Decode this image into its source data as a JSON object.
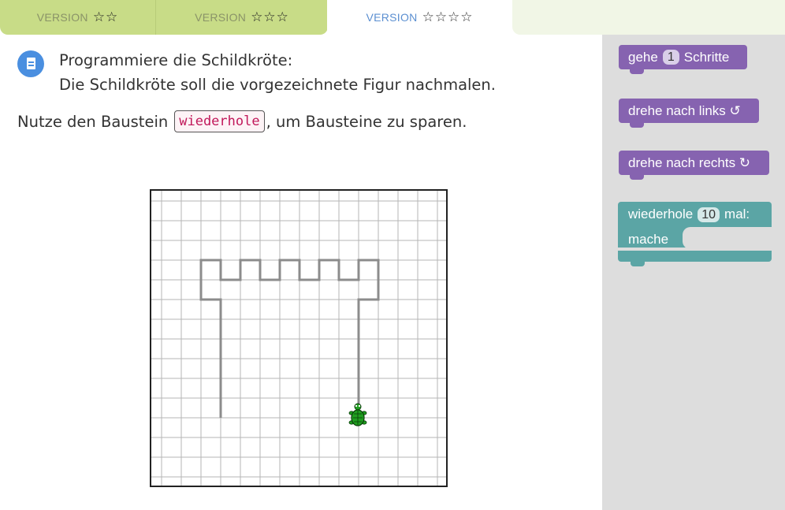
{
  "tabs": [
    {
      "label": "VERSION",
      "stars": "☆☆"
    },
    {
      "label": "VERSION",
      "stars": "☆☆☆"
    },
    {
      "label": "VERSION",
      "stars": "☆☆☆☆"
    }
  ],
  "task": {
    "line1": "Programmiere die Schildkröte:",
    "line2": "Die Schildkröte soll die vorgezeichnete Figur nachmalen.",
    "hint_before": "Nutze den Baustein",
    "hint_code": "wiederhole",
    "hint_after": ", um Bausteine zu sparen."
  },
  "blocks": {
    "move": {
      "before": "gehe",
      "value": "1",
      "after": "Schritte"
    },
    "turn_left": {
      "label": "drehe nach links ↺"
    },
    "turn_right": {
      "label": "drehe nach rechts ↻"
    },
    "repeat": {
      "before": "wiederhole",
      "value": "10",
      "after": "mal:",
      "do": "mache"
    }
  },
  "colors": {
    "tab_inactive": "#c8dc87",
    "tab_active_text": "#5b8fd1",
    "block_purple": "#8663b0",
    "block_teal": "#5ba5a5",
    "turtle": "#1f9e1f"
  }
}
